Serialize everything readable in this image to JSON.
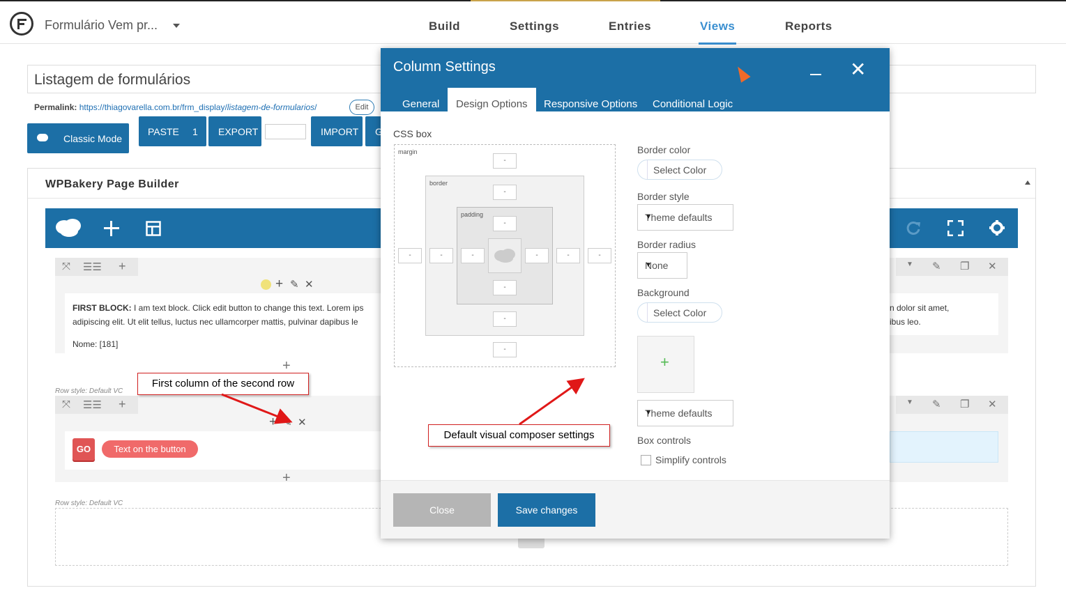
{
  "header": {
    "form_name": "Formulário Vem pr...",
    "tabs": [
      "Build",
      "Settings",
      "Entries",
      "Views",
      "Reports"
    ],
    "active_tab": "Views"
  },
  "view_title": "Listagem de formulários",
  "permalink": {
    "label": "Permalink:",
    "url_base": "https://thiagovarella.com.br/frm_display/",
    "url_slug": "listagem-de-formularios",
    "url_tail": "/",
    "edit_label": "Edit"
  },
  "toolbar": {
    "classic_mode": "Classic Mode",
    "paste": "PASTE",
    "paste_count": "1",
    "export": "EXPORT",
    "import": "IMPORT",
    "g": "G"
  },
  "builder": {
    "title": "WPBakery Page Builder",
    "row1_text_bold": "FIRST BLOCK:",
    "row1_text": " I am text block. Click edit button to change this text. Lorem ips",
    "row1_text2": "adipiscing elit. Ut elit tellus, luctus nec ullamcorper mattis, pulvinar dapibus le",
    "row1_right1": "n dolor sit amet,",
    "row1_right2": "ibus leo.",
    "row1_nome": "Nome: [181]",
    "row_style": "Row style: Default VC",
    "go_label": "GO",
    "button_text": "Text on the button"
  },
  "callouts": {
    "first_column": "First column of the second row",
    "default_settings": "Default visual composer settings"
  },
  "modal": {
    "title": "Column Settings",
    "tabs": [
      "General",
      "Design Options",
      "Responsive Options",
      "Conditional Logic"
    ],
    "active_tab": "Design Options",
    "css_box_label": "CSS box",
    "margin_label": "margin",
    "border_label": "border",
    "padding_label": "padding",
    "dash": "-",
    "border_color_label": "Border color",
    "select_color": "Select Color",
    "border_style_label": "Border style",
    "border_style_value": "Theme defaults",
    "border_radius_label": "Border radius",
    "border_radius_value": "None",
    "background_label": "Background",
    "background_style_value": "Theme defaults",
    "box_controls_label": "Box controls",
    "simplify_label": "Simplify controls",
    "close_label": "Close",
    "save_label": "Save changes"
  },
  "colors": {
    "brand_blue": "#1c6fa6",
    "accent_link": "#3a8fd0",
    "go_red": "#e05555",
    "callout_red": "#d12020"
  }
}
